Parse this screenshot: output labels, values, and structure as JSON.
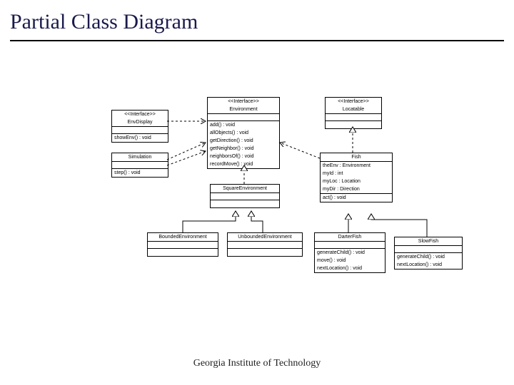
{
  "title": "Partial Class Diagram",
  "footer": "Georgia Institute of Technology",
  "envDisplay": {
    "stereo": "<<Interface>>",
    "name": "EnvDisplay",
    "op1": "showEnv() : void"
  },
  "environment": {
    "stereo": "<<Interface>>",
    "name": "Environment",
    "op1": "add() : void",
    "op2": "allObjects() : void",
    "op3": "getDirection() : void",
    "op4": "getNeighbor() : void",
    "op5": "neighborsOf() : void",
    "op6": "recordMove() : void"
  },
  "locatable": {
    "stereo": "<<Interface>>",
    "name": "Locatable"
  },
  "simulation": {
    "name": "Simulation",
    "op1": "step() : void"
  },
  "fish": {
    "name": "Fish",
    "a1": "theEnv : Environment",
    "a2": "myId : int",
    "a3": "myLoc : Location",
    "a4": "myDir : Direction",
    "op1": "act() : void"
  },
  "squareEnv": {
    "name": "SquareEnvironment"
  },
  "boundedEnv": {
    "name": "BoundedEnvironment"
  },
  "unboundedEnv": {
    "name": "UnboundedEnvironment"
  },
  "darterFish": {
    "name": "DarterFish",
    "op1": "generateChild() : void",
    "op2": "move() : void",
    "op3": "nextLocation() : void"
  },
  "slowFish": {
    "name": "SlowFish",
    "op1": "generateChild() : void",
    "op2": "nextLocation() : void"
  }
}
